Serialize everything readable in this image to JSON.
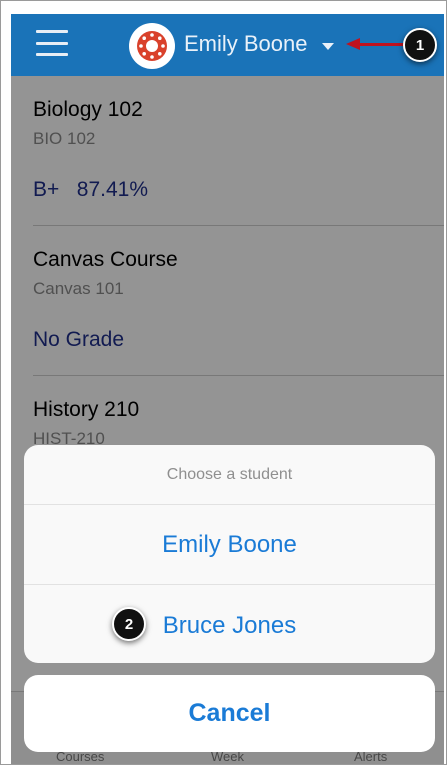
{
  "header": {
    "student_name": "Emily Boone",
    "menu_icon": "hamburger-menu-icon",
    "avatar_icon": "canvas-logo-icon",
    "dropdown_icon": "caret-down-icon",
    "background_color": "#1a73b8"
  },
  "callouts": {
    "one": "1",
    "two": "2"
  },
  "courses": [
    {
      "title": "Biology 102",
      "code": "BIO 102",
      "grade": "B+   87.41%"
    },
    {
      "title": "Canvas Course",
      "code": "Canvas 101",
      "grade": "No Grade"
    },
    {
      "title": "History 210",
      "code": "HIST-210",
      "grade": ""
    }
  ],
  "tabbar": {
    "tabs": [
      "Courses",
      "Week",
      "Alerts"
    ]
  },
  "action_sheet": {
    "title": "Choose a student",
    "options": [
      "Emily Boone",
      "Bruce Jones"
    ],
    "cancel_label": "Cancel",
    "accent_color": "#1a7bd6"
  }
}
